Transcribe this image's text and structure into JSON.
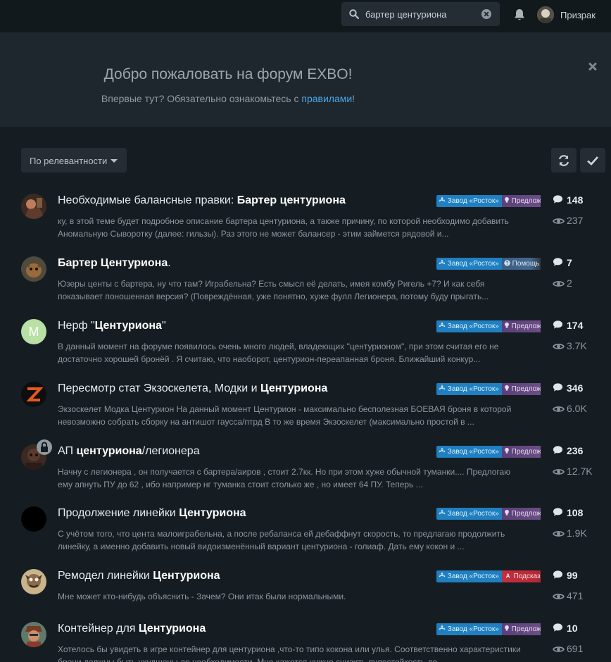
{
  "header": {
    "search_value": "бартер центуриона",
    "user_name": "Призрак"
  },
  "hero": {
    "title": "Добро пожаловать на форум EXBO!",
    "subtitle_before": "Впервые тут? Обязательно ознакомьтесь с ",
    "subtitle_link": "правилами",
    "subtitle_after": "!"
  },
  "toolbar": {
    "sort_label": "По релевантности"
  },
  "colors": {
    "background": "#161d22",
    "tag_primary": "#1f7fc0",
    "tag_suggestion": "#5a3f78",
    "tag_help": "#3a5d86",
    "tag_red": "#c0303f",
    "link": "#4aa8e8"
  },
  "discussions": [
    {
      "title_pre": "Необходимые балансные правки: ",
      "title_hl": "Бартер центуриона",
      "title_post": "",
      "excerpt": "ку, в этой теме будет подробное описание бартера центуриона, а также причину, по которой необходимо добавить Аномальную Сыворотку (далее: гильзы). Раз этого не может балансер - этим займется рядовой и...",
      "tag_primary": "Завод «Росток»",
      "tag_secondary": "Предложения",
      "tag_secondary_style": "suggestion",
      "tag_secondary_icon": "bulb-icon",
      "replies": "148",
      "views": "237"
    },
    {
      "title_pre": "",
      "title_hl": "Бартер Центуриона",
      "title_post": ".",
      "excerpt": "Юзеры центы с бартера, ну что там? Играбельна? Есть смысл её делать, имея комбу Ригель +7? И как себя показывает поношенная версия? (Повреждённая, уже понятно, хуже фулл Легионера, потому буду прыгать...",
      "tag_primary": "Завод «Росток»",
      "tag_secondary": "Помощь",
      "tag_secondary_style": "help",
      "tag_secondary_icon": "question-icon",
      "replies": "7",
      "views": "2"
    },
    {
      "title_pre": "Нерф \"",
      "title_hl": "Центуриона",
      "title_post": "\"",
      "excerpt": "В данный момент на форуме появилось очень много людей, владеющих \"центурионом\", при этом считая его не достаточно хорошей бронёй . Я считаю, что наоборот, центурион-переапанная броня. Ближайший конкур...",
      "tag_primary": "Завод «Росток»",
      "tag_secondary": "Предложения",
      "tag_secondary_style": "suggestion",
      "tag_secondary_icon": "bulb-icon",
      "avatar_letter": "M",
      "replies": "174",
      "views": "3.7K"
    },
    {
      "title_pre": "Пересмотр стат Экзоскелета, Модки и ",
      "title_hl": "Центуриона",
      "title_post": "",
      "excerpt": "Экзоскелет Модка Центурион На данный момент Центурион - максимально бесполезная БОЕВАЯ броня в которой невозможно собрать сборку на антишот гаусса/птрд В то же время Экзоскелет (максимально простой в ...",
      "tag_primary": "Завод «Росток»",
      "tag_secondary": "Предложения",
      "tag_secondary_style": "suggestion",
      "tag_secondary_icon": "bulb-icon",
      "replies": "346",
      "views": "6.0K"
    },
    {
      "title_pre": "АП ",
      "title_hl": "центуриона",
      "title_post": "/легионера",
      "excerpt": "Начну с легионера , он получается с бартера/аиров , стоит 2.7кк. Но при этом хуже обычной туманки.... Предлогаю ему апнуть ПУ до 62 , ибо например нг туманка стоит столько же , но имеет 64 ПУ. Теперь ...",
      "tag_primary": "Завод «Росток»",
      "tag_secondary": "Предложения",
      "tag_secondary_style": "suggestion",
      "tag_secondary_icon": "bulb-icon",
      "locked": true,
      "replies": "236",
      "views": "12.7K"
    },
    {
      "title_pre": "Продолжение линейки ",
      "title_hl": "Центуриона",
      "title_post": "",
      "excerpt": "С учётом того, что цента малоиграбельна, а после ребаланса ей дебаффнут скорость, то предлагаю продолжить линейку, а именно добавить новый видоизменённый вариант центуриона - голиаф. Дать ему кокон и ...",
      "tag_primary": "Завод «Росток»",
      "tag_secondary": "Предложения",
      "tag_secondary_style": "suggestion",
      "tag_secondary_icon": "bulb-icon",
      "replies": "108",
      "views": "1.9K"
    },
    {
      "title_pre": "Ремодел линейки ",
      "title_hl": "Центуриона",
      "title_post": "",
      "excerpt": "Мне может кто-нибудь объяснить - Зачем? Они итак были нормальными.",
      "tag_primary": "Завод «Росток»",
      "tag_secondary": "Подсказки",
      "tag_secondary_style": "red",
      "tag_secondary_icon": "translate-icon",
      "replies": "99",
      "views": "471"
    },
    {
      "title_pre": "Контейнер для ",
      "title_hl": "Центуриона",
      "title_post": "",
      "excerpt": "Хотелось бы увидеть в игре контейнер для центуриона ,что-то типо кокона или улья. Соответственно характеристики брони должны быть ухудшены до необходимости. Мне кажется нужно снизить пулестойкость до ...",
      "tag_primary": "Завод «Росток»",
      "tag_secondary": "Предложения",
      "tag_secondary_style": "suggestion",
      "tag_secondary_icon": "bulb-icon",
      "replies": "10",
      "views": "691"
    }
  ]
}
